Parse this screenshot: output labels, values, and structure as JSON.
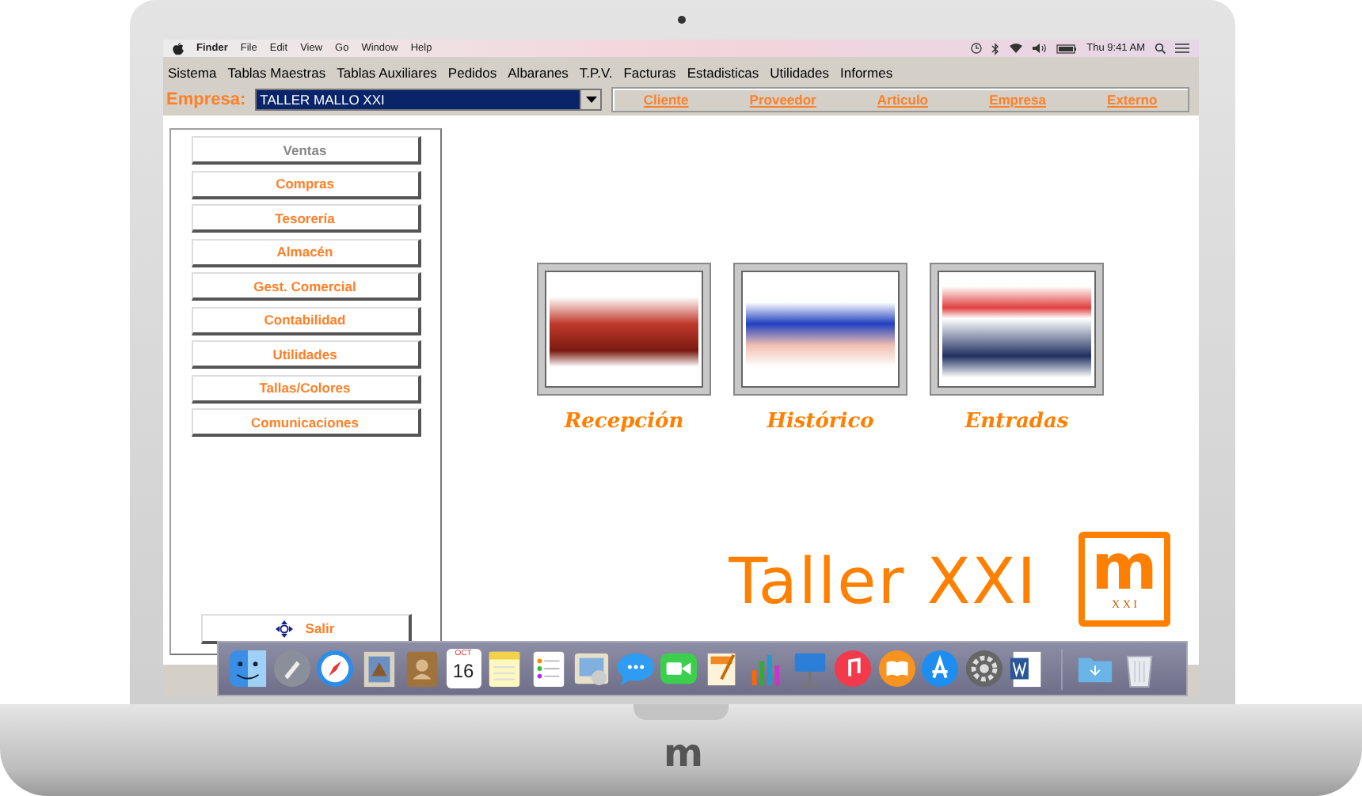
{
  "mac_menu_bar": {
    "items": [
      "Finder",
      "File",
      "Edit",
      "View",
      "Go",
      "Window",
      "Help"
    ],
    "clock": "Thu 9:41 AM"
  },
  "menu_bar": {
    "items": [
      "Sistema",
      "Tablas Maestras",
      "Tablas Auxiliares",
      "Pedidos",
      "Albaranes",
      "T.P.V.",
      "Facturas",
      "Estadisticas",
      "Utilidades",
      "Informes"
    ]
  },
  "company": {
    "label": "Empresa:",
    "value": "TALLER MALLO XXI"
  },
  "quick_links": [
    {
      "label": "Cliente"
    },
    {
      "label": "Proveedor"
    },
    {
      "label": "Articulo"
    },
    {
      "label": "Empresa"
    },
    {
      "label": "Externo"
    }
  ],
  "sidebar": {
    "items": [
      {
        "label": "Ventas",
        "disabled": true
      },
      {
        "label": "Compras",
        "disabled": false
      },
      {
        "label": "Tesorería",
        "disabled": false
      },
      {
        "label": "Almacén",
        "disabled": false
      },
      {
        "label": "Gest. Comercial",
        "disabled": false
      },
      {
        "label": "Contabilidad",
        "disabled": false
      },
      {
        "label": "Utilidades",
        "disabled": false
      },
      {
        "label": "Tallas/Colores",
        "disabled": false
      },
      {
        "label": "Comunicaciones",
        "disabled": false
      }
    ],
    "exit_button": "Salir"
  },
  "modules": [
    {
      "label": "Recepción"
    },
    {
      "label": "Histórico"
    },
    {
      "label": "Entradas"
    }
  ],
  "brand": {
    "title": "Taller XXI",
    "logo_letter": "m",
    "logo_subtitle": "X X I"
  },
  "dock": {
    "calendar_month": "OCT",
    "calendar_day": "16"
  },
  "laptop": {
    "logo": "m"
  }
}
